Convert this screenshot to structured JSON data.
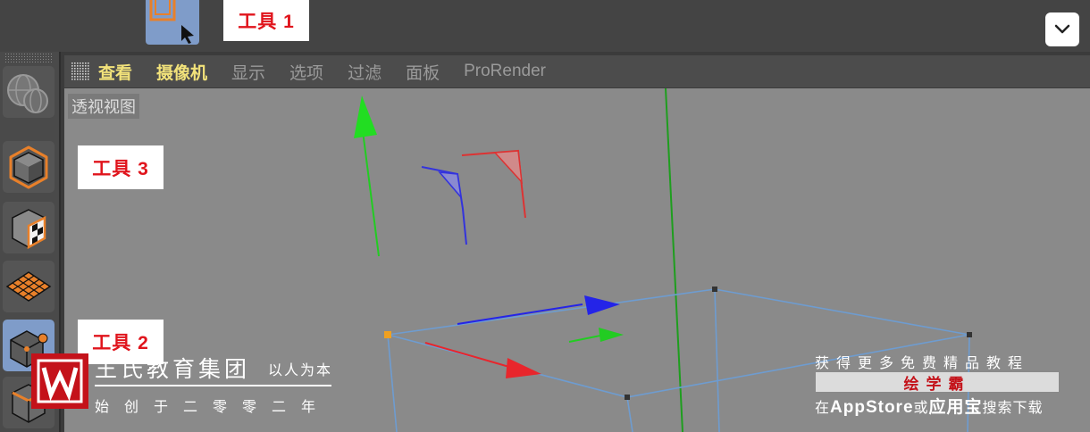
{
  "labels": {
    "tool1": "工具 1",
    "tool2": "工具 2",
    "tool3": "工具 3"
  },
  "menu": {
    "items": [
      {
        "label": "查看"
      },
      {
        "label": "摄像机"
      },
      {
        "label": "显示"
      },
      {
        "label": "选项"
      },
      {
        "label": "过滤"
      },
      {
        "label": "面板"
      },
      {
        "label": "ProRender"
      }
    ]
  },
  "viewport": {
    "label": "透视视图"
  },
  "watermark": {
    "org_name": "王氏教育集团",
    "slogan": "以人为本",
    "since": "始创于二零零二年"
  },
  "promo": {
    "line1": "获得更多免费精品教程",
    "brand": "绘学霸",
    "line2_prefix": "在",
    "line2_store": "AppStore",
    "line2_or": "或",
    "line2_app": "应用宝",
    "line2_suffix": "搜索下载"
  },
  "icons": {
    "top_tool": "select-rectangle-icon",
    "collapse": "chevron-down-icon",
    "grip": "grip-icon",
    "tool_a": "globe-render-icon",
    "tool_b": "cube-model-icon",
    "tool_c": "texture-cube-icon",
    "tool_d": "polygon-grid-icon",
    "tool_e": "point-edit-icon",
    "tool_f": "edge-cube-icon"
  },
  "colors": {
    "accent": "#7f9cc9",
    "menu_active": "#f2e27a",
    "label_red": "#e0141c",
    "axis_x": "#e8262c",
    "axis_y": "#22cc22",
    "axis_z": "#2424e8",
    "box_edges": "#6e9cd0"
  }
}
